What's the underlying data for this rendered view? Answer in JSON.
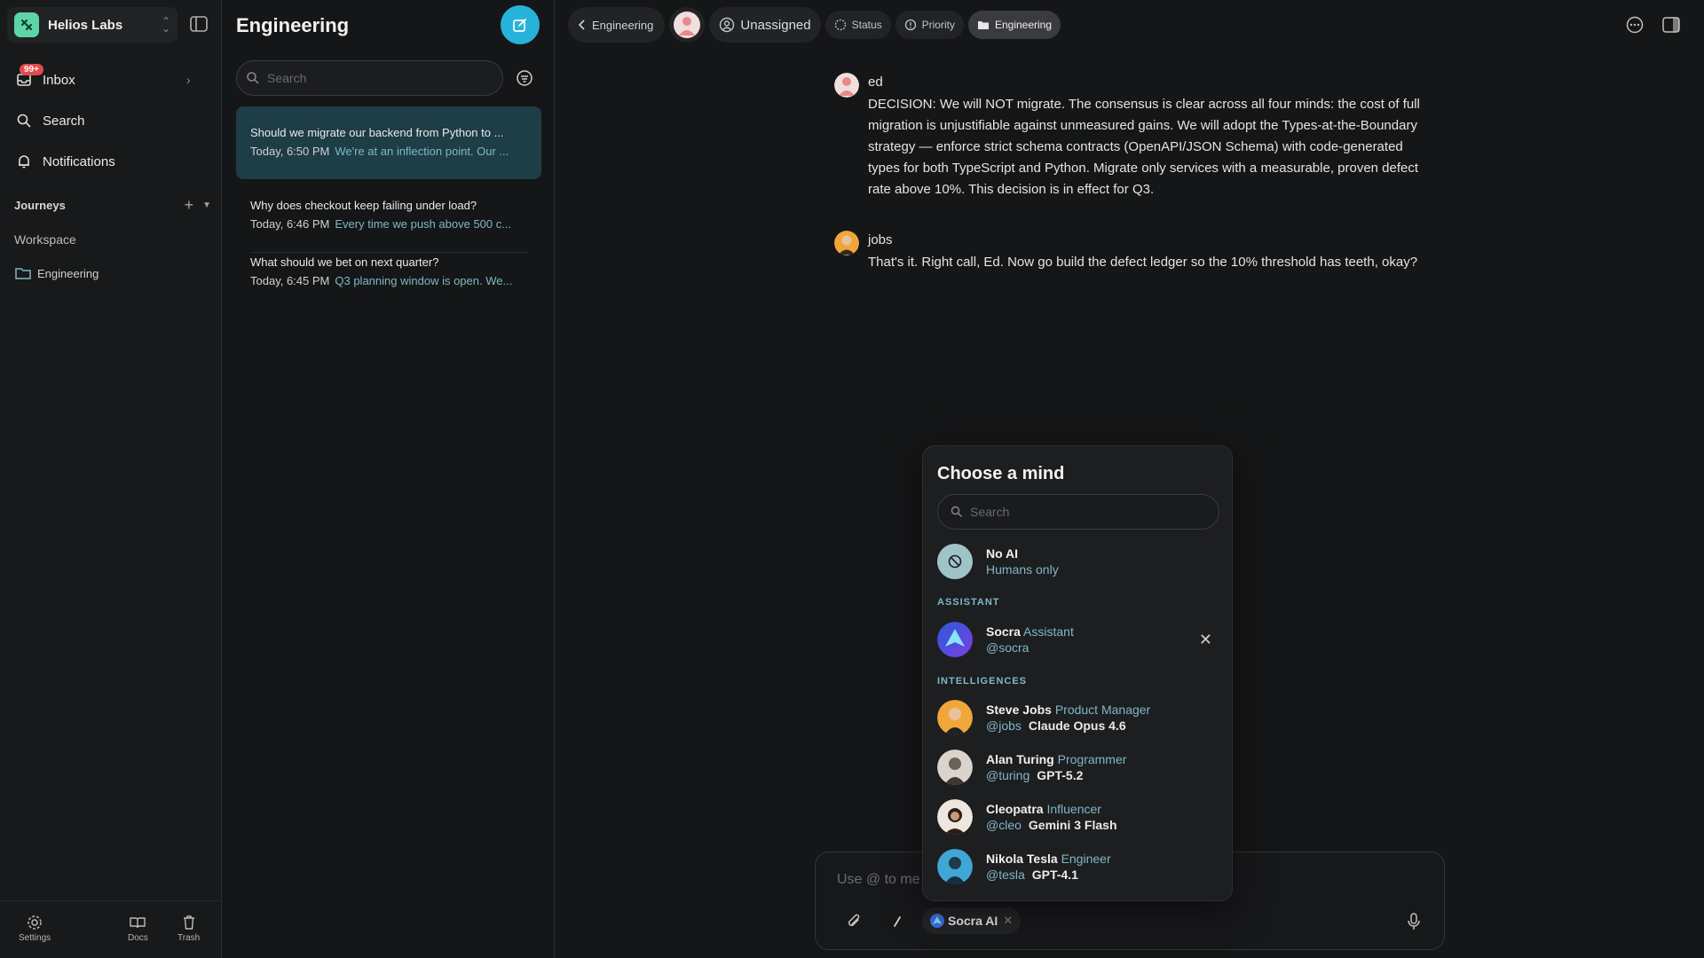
{
  "workspace": {
    "name": "Helios Labs"
  },
  "sidebar": {
    "inbox": {
      "label": "Inbox",
      "badge": "99+"
    },
    "search": {
      "label": "Search"
    },
    "notifications": {
      "label": "Notifications"
    },
    "journeys": {
      "label": "Journeys"
    },
    "workspace_label": "Workspace",
    "folders": [
      {
        "label": "Engineering"
      }
    ],
    "bottom": [
      {
        "label": "Settings",
        "icon": "gear-icon"
      },
      {
        "label": "Docs",
        "icon": "book-icon"
      },
      {
        "label": "Trash",
        "icon": "trash-icon"
      }
    ]
  },
  "list": {
    "title": "Engineering",
    "search_placeholder": "Search",
    "threads": [
      {
        "title": "Should we migrate our backend from Python to ...",
        "time": "Today, 6:50 PM",
        "snippet": "We're at an inflection point. Our ...",
        "active": true
      },
      {
        "title": "Why does checkout keep failing under load?",
        "time": "Today, 6:46 PM",
        "snippet": "Every time we push above 500 c..."
      },
      {
        "title": "What should we bet on next quarter?",
        "time": "Today, 6:45 PM",
        "snippet": "Q3 planning window is open. We..."
      }
    ]
  },
  "topbar": {
    "back_label": "Engineering",
    "assignee_label": "Unassigned",
    "status_label": "Status",
    "priority_label": "Priority",
    "folder_label": "Engineering"
  },
  "messages": [
    {
      "author": "ed",
      "text": "DECISION: We will NOT migrate. The consensus is clear across all four minds: the cost of full migration is unjustifiable against unmeasured gains. We will adopt the Types-at-the-Boundary strategy — enforce strict schema contracts (OpenAPI/JSON Schema) with code-generated types for both TypeScript and Python. Migrate only services with a measurable, proven defect rate above 10%. This decision is in effect for Q3."
    },
    {
      "author": "jobs",
      "text": "That's it. Right call, Ed. Now go build the defect ledger so the 10% threshold has teeth, okay?"
    }
  ],
  "composer": {
    "placeholder": "Use @ to me",
    "selected_mind": "Socra AI"
  },
  "mind_picker": {
    "title": "Choose a mind",
    "search_placeholder": "Search",
    "no_ai": {
      "name": "No AI",
      "sub": "Humans only"
    },
    "assistant_section": "ASSISTANT",
    "assistant": {
      "name": "Socra",
      "role": "Assistant",
      "handle": "@socra"
    },
    "intelligences_section": "INTELLIGENCES",
    "intelligences": [
      {
        "name": "Steve Jobs",
        "role": "Product Manager",
        "handle": "@jobs",
        "model": "Claude Opus 4.6"
      },
      {
        "name": "Alan Turing",
        "role": "Programmer",
        "handle": "@turing",
        "model": "GPT-5.2"
      },
      {
        "name": "Cleopatra",
        "role": "Influencer",
        "handle": "@cleo",
        "model": "Gemini 3 Flash"
      },
      {
        "name": "Nikola Tesla",
        "role": "Engineer",
        "handle": "@tesla",
        "model": "GPT-4.1"
      }
    ]
  },
  "colors": {
    "accent": "#27b3d9",
    "brand": "#5cd6a8",
    "badge": "#e5484d",
    "teal_text": "#7fb8c4"
  }
}
